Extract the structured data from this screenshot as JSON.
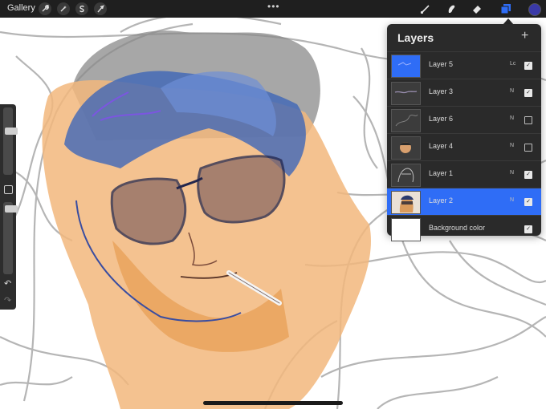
{
  "topbar": {
    "gallery_label": "Gallery",
    "left_tools": [
      "wrench-icon",
      "magic-wand-icon",
      "selection-s-icon",
      "transform-arrow-icon"
    ],
    "dots": "•••",
    "right_tools": [
      "brush-icon",
      "smudge-icon",
      "eraser-icon",
      "layers-icon"
    ],
    "current_color": "#3a39a8"
  },
  "sidebar": {
    "brush_size_level": 0.33,
    "opacity_level": 0.05,
    "undo_symbol": "↶",
    "redo_symbol": "↷"
  },
  "layers_panel": {
    "title": "Layers",
    "add_symbol": "+",
    "layers": [
      {
        "name": "Layer 5",
        "blend": "Lc",
        "visible": true,
        "selected": false
      },
      {
        "name": "Layer 3",
        "blend": "N",
        "visible": true,
        "selected": false
      },
      {
        "name": "Layer 6",
        "blend": "N",
        "visible": false,
        "selected": false
      },
      {
        "name": "Layer 4",
        "blend": "N",
        "visible": false,
        "selected": false
      },
      {
        "name": "Layer 1",
        "blend": "N",
        "visible": true,
        "selected": false
      },
      {
        "name": "Layer 2",
        "blend": "N",
        "visible": true,
        "selected": true
      },
      {
        "name": "Background color",
        "blend": "",
        "visible": true,
        "selected": false
      }
    ]
  },
  "colors": {
    "accent": "#2f6df6",
    "panel_bg": "#2a2a2a",
    "topbar_bg": "#1f1f1f"
  }
}
